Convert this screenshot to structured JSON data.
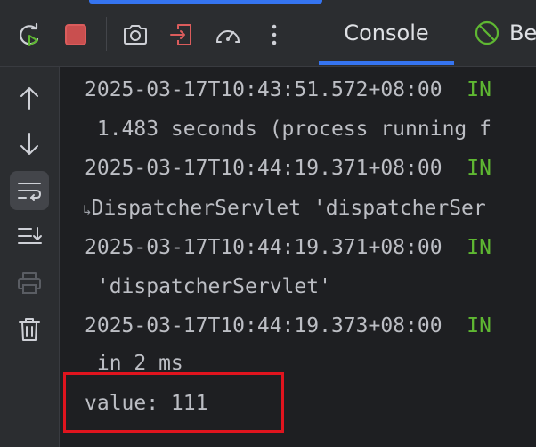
{
  "toolbar": {
    "tabs": [
      {
        "label": "Console"
      },
      {
        "label": "Be"
      }
    ]
  },
  "console": {
    "lines": [
      {
        "text": "2025-03-17T10:43:51.572+08:00  ",
        "level": "IN"
      },
      {
        "text": " 1.483 seconds (process running f"
      },
      {
        "text": "2025-03-17T10:44:19.371+08:00  ",
        "level": "IN"
      },
      {
        "wrap": "↳",
        "text": "DispatcherServlet 'dispatcherSer"
      },
      {
        "text": "2025-03-17T10:44:19.371+08:00  ",
        "level": "IN"
      },
      {
        "text": " 'dispatcherServlet'"
      },
      {
        "text": "2025-03-17T10:44:19.373+08:00  ",
        "level": "IN"
      },
      {
        "text": " in 2 ms"
      },
      {
        "text": "value: 111"
      }
    ]
  },
  "colors": {
    "background": "#1e1f22",
    "panel": "#2b2d30",
    "accent": "#3574f0",
    "text": "#bcbec4",
    "info_level": "#5fb832",
    "highlight_box": "#e0141e",
    "stop_icon": "#db5c5c"
  },
  "icons": {
    "toolbar": [
      "rerun-icon",
      "stop-icon",
      "screenshot-icon",
      "exit-icon",
      "profiler-icon",
      "more-icon"
    ],
    "sidebar": [
      "up-arrow-icon",
      "down-arrow-icon",
      "soft-wrap-icon",
      "scroll-to-end-icon",
      "print-icon",
      "trash-icon"
    ],
    "tab_second": "no-entry-icon"
  }
}
